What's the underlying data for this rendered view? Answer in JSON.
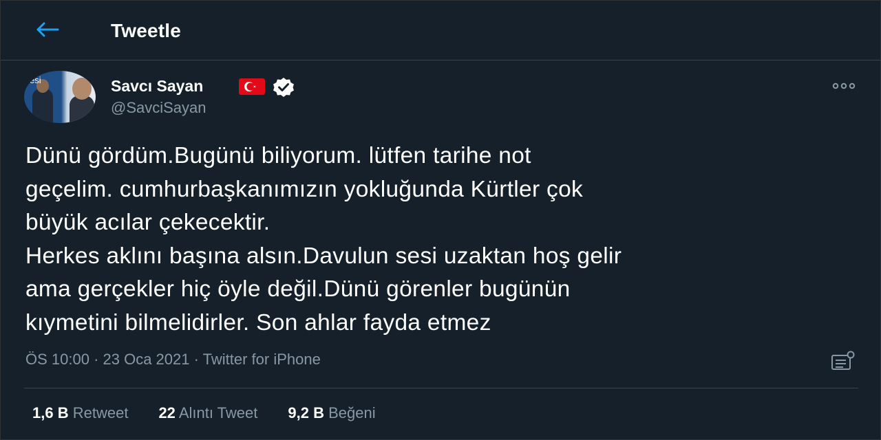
{
  "header": {
    "title": "Tweetle",
    "back_icon": "arrow-left-icon",
    "accent": "#1da1f2"
  },
  "author": {
    "name": "Savcı Sayan",
    "handle": "@SavciSayan",
    "avatar_text": "esi",
    "badges": [
      "turkish-flag-icon",
      "verified-badge-icon"
    ]
  },
  "tweet": {
    "text": "Dünü gördüm.Bugünü biliyorum. lütfen tarihe not\ngeçelim. cumhurbaşkanımızın yokluğunda Kürtler çok\nbüyük acılar çekecektir.\nHerkes aklını başına alsın.Davulun sesi uzaktan hoş gelir\nama gerçekler hiç öyle değil.Dünü görenler bugünün\nkıymetini bilmelidirler. Son ahlar fayda etmez"
  },
  "meta": {
    "time": "ÖS 10:00",
    "sep1": " · ",
    "date": "23 Oca 2021",
    "sep2": " · ",
    "source": "Twitter for iPhone"
  },
  "stats": [
    {
      "count": "1,6 B",
      "label": "Retweet"
    },
    {
      "count": "22",
      "label": "Alıntı Tweet"
    },
    {
      "count": "9,2 B",
      "label": "Beğeni"
    }
  ],
  "colors": {
    "background": "#15202b",
    "muted": "#8899a6",
    "text": "#ffffff",
    "flag": "#e30a17"
  }
}
